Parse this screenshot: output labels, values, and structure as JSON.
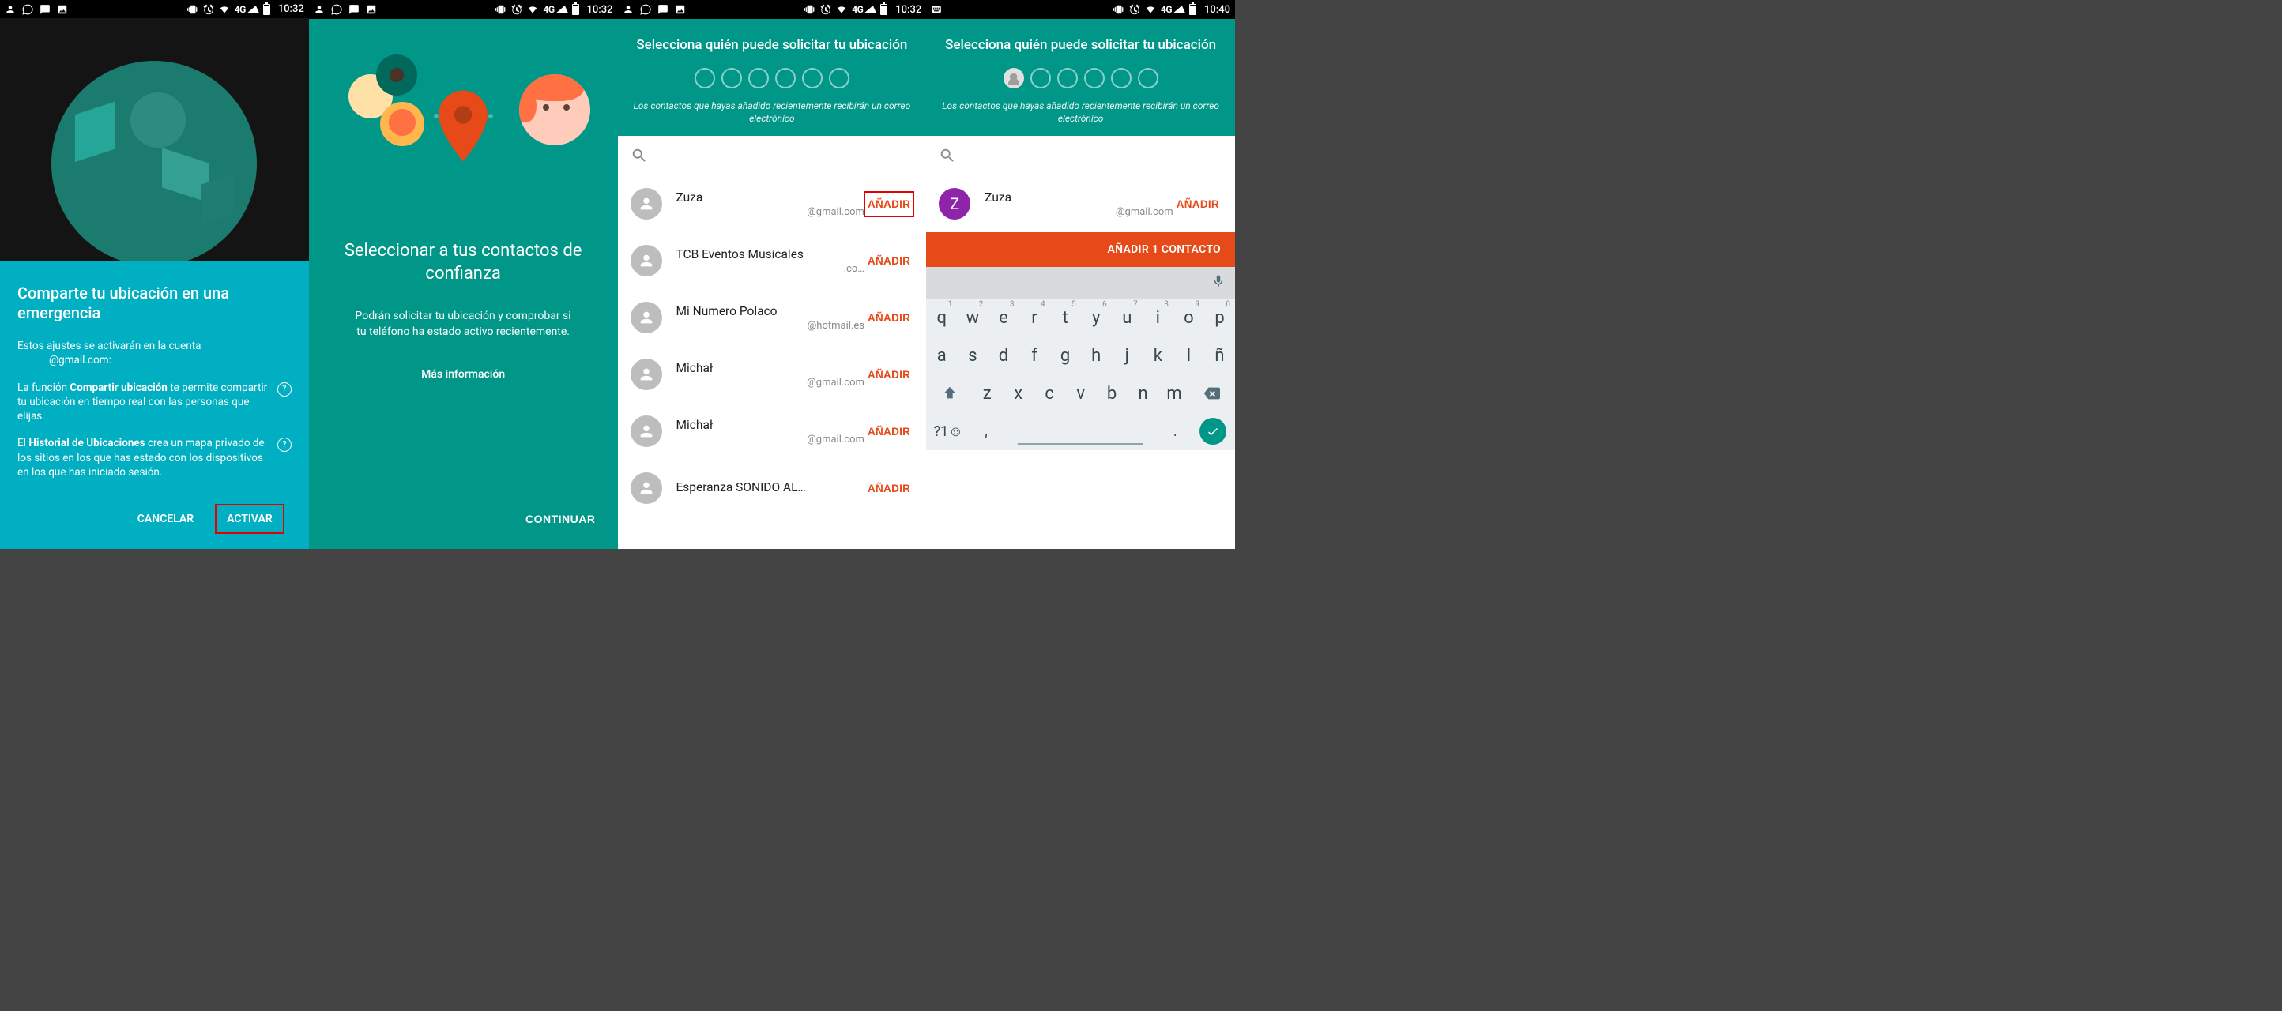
{
  "status": {
    "time_a": "10:32",
    "time_b": "10:40",
    "net": "4G"
  },
  "screen1": {
    "title": "Comparte tu ubicación en una emergencia",
    "intro_a": "Estos ajustes se activarán en la cuenta",
    "intro_b": "@gmail.com:",
    "p1_a": "La función ",
    "p1_b": "Compartir ubicación",
    "p1_c": " te permite compartir tu ubicación en tiempo real con las personas que elijas.",
    "p2_a": "El ",
    "p2_b": "Historial de Ubicaciones",
    "p2_c": " crea un mapa privado de los sitios en los que has estado con los dispositivos en los que has iniciado sesión.",
    "cancel": "CANCELAR",
    "activate": "ACTIVAR"
  },
  "screen2": {
    "title": "Seleccionar a tus contactos de confianza",
    "body": "Podrán solicitar tu ubicación y comprobar si tu teléfono ha estado activo recientemente.",
    "more": "Más información",
    "continue": "CONTINUAR"
  },
  "screen3": {
    "title": "Selecciona quién puede solicitar tu ubicación",
    "subtitle": "Los contactos que hayas añadido recientemente recibirán un correo electrónico",
    "add": "AÑADIR",
    "contacts": [
      {
        "name": "Zuza",
        "email": "@gmail.com"
      },
      {
        "name": "TCB Eventos Musicales",
        "email": ".co…"
      },
      {
        "name": "Mi Numero Polaco",
        "email": "@hotmail.es"
      },
      {
        "name": "Michał",
        "email": "@gmail.com"
      },
      {
        "name": "Michał",
        "email": "@gmail.com"
      },
      {
        "name": "Esperanza SONIDO AL…",
        "email": ""
      }
    ]
  },
  "screen4": {
    "title": "Selecciona quién puede solicitar tu ubicación",
    "subtitle": "Los contactos que hayas añadido recientemente recibirán un correo electrónico",
    "add": "AÑADIR",
    "contact": {
      "name": "Zuza",
      "email": "@gmail.com",
      "initial": "Z"
    },
    "orange": "AÑADIR 1 CONTACTO",
    "kbd": {
      "row1": [
        "q",
        "w",
        "e",
        "r",
        "t",
        "y",
        "u",
        "i",
        "o",
        "p"
      ],
      "nums": [
        "1",
        "2",
        "3",
        "4",
        "5",
        "6",
        "7",
        "8",
        "9",
        "0"
      ],
      "row2": [
        "a",
        "s",
        "d",
        "f",
        "g",
        "h",
        "j",
        "k",
        "l",
        "ñ"
      ],
      "row3": [
        "z",
        "x",
        "c",
        "v",
        "b",
        "n",
        "m"
      ],
      "sym": "?1☺",
      "comma": ",",
      "period": "."
    }
  }
}
